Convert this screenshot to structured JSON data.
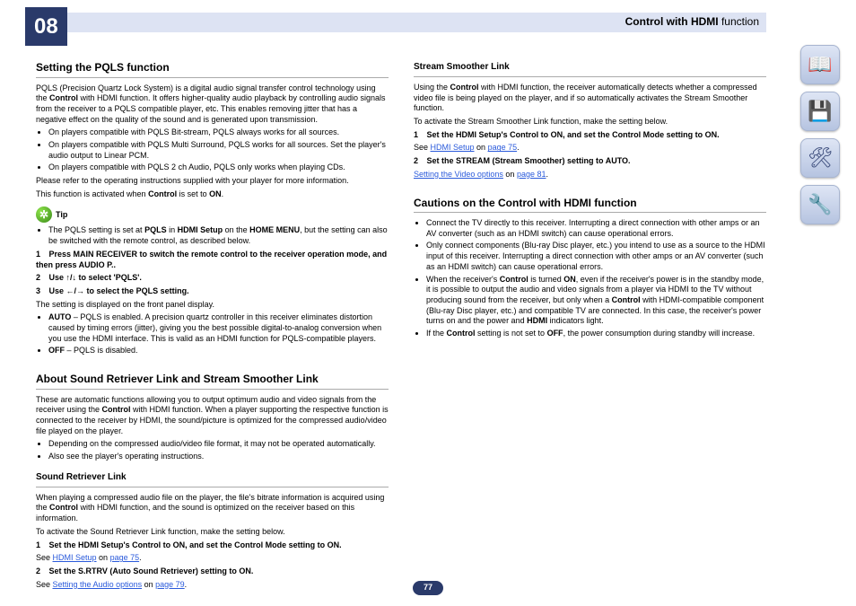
{
  "chapter": "08",
  "headerTitlePrefix": "Control with HDMI ",
  "headerTitleSuffix": "function",
  "pageNumber": "77",
  "left": {
    "s1": {
      "title": "Setting the PQLS function",
      "p1a": "PQLS (Precision Quartz Lock System) is a digital audio signal transfer control technology using the ",
      "p1b": "Control",
      "p1c": " with HDMI function. It offers higher-quality audio playback by controlling audio signals from the receiver to a PQLS compatible player, etc. This enables removing jitter that has a negative effect on the quality of the sound and is generated upon transmission.",
      "b1": "On players compatible with PQLS Bit-stream, PQLS always works for all sources.",
      "b2": "On players compatible with PQLS Multi Surround, PQLS works for all sources. Set the player's audio output to Linear PCM.",
      "b3": "On players compatible with PQLS 2 ch Audio, PQLS only works when playing CDs.",
      "p2": "Please refer to the operating instructions supplied with your player for more information.",
      "p3a": "This function is activated when ",
      "p3b": "Control",
      "p3c": " is set to ",
      "p3d": "ON",
      "p3e": ".",
      "tip": "Tip",
      "tipb1a": "The PQLS setting is set at ",
      "tipb1b": "PQLS",
      "tipb1c": " in ",
      "tipb1d": "HDMI Setup",
      "tipb1e": " on the ",
      "tipb1f": "HOME MENU",
      "tipb1g": ", but the setting can also be switched with the remote control, as described below.",
      "st1a": "Press MAIN RECEIVER to switch the remote control to the receiver operation mode, and then press AUDIO P..",
      "st2a": "Use ",
      "st2b": "↑/↓",
      "st2c": " to select 'PQLS'.",
      "st3a": "Use ",
      "st3b": "←/→",
      "st3c": " to select the PQLS setting.",
      "p4": "The setting is displayed on the front panel display.",
      "sb1a": "AUTO",
      "sb1b": " – PQLS is enabled. A precision quartz controller in this receiver eliminates distortion caused by timing errors (jitter), giving you the best possible digital-to-analog conversion when you use the HDMI interface. This is valid as an HDMI function for PQLS-compatible players.",
      "sb2a": "OFF",
      "sb2b": " – PQLS is disabled."
    },
    "s2": {
      "title": "About Sound Retriever Link and Stream Smoother Link",
      "p1a": "These are automatic functions allowing you to output optimum audio and video signals from the receiver using the ",
      "p1b": "Control",
      "p1c": " with HDMI function. When a player supporting the respective function is connected to the receiver by HDMI, the sound/picture is optimized for the compressed audio/video file played on the player.",
      "b1": "Depending on the compressed audio/video file format, it may not be operated automatically.",
      "b2": "Also see the player's operating instructions.",
      "sub": "Sound Retriever Link",
      "p2a": "When playing a compressed audio file on the player, the file's bitrate information is acquired using the ",
      "p2b": "Control",
      "p2c": " with HDMI function, and the sound is optimized on the receiver based on this information.",
      "p3": "To activate the Sound Retriever Link function, make the setting below.",
      "st1": "Set the HDMI Setup's Control to ON, and set the Control Mode setting to ON.",
      "see1a": "See ",
      "see1L": "HDMI Setup",
      "see1b": " on ",
      "see1P": "page 75",
      "see1c": ".",
      "st2": "Set the S.RTRV (Auto Sound Retriever) setting to ON.",
      "see2a": "See ",
      "see2L": "Setting the Audio options",
      "see2b": " on ",
      "see2P": "page 79",
      "see2c": "."
    }
  },
  "right": {
    "s1": {
      "sub": "Stream Smoother Link",
      "p1a": "Using the ",
      "p1b": "Control",
      "p1c": " with HDMI function, the receiver automatically detects whether a compressed video file is being played on the player, and if so automatically activates the Stream Smoother function.",
      "p2": "To activate the Stream Smoother Link function, make the setting below.",
      "st1": "Set the HDMI Setup's Control to ON, and set the Control Mode setting to ON.",
      "see1a": "See ",
      "see1L": "HDMI Setup",
      "see1b": " on ",
      "see1P": "page 75",
      "see1c": ".",
      "st2": "Set the STREAM (Stream Smoother) setting to AUTO.",
      "see2a": "See ",
      "see2L": "Setting the Video options",
      "see2b": " on ",
      "see2P": "page 81",
      "see2c": "."
    },
    "s2": {
      "title": "Cautions on the Control with HDMI function",
      "b1": "Connect the TV directly to this receiver. Interrupting a direct connection with other amps or an AV converter (such as an HDMI switch) can cause operational errors.",
      "b2": "Only connect components (Blu-ray Disc player, etc.) you intend to use as a source to the HDMI input of this receiver. Interrupting a direct connection with other amps or an AV converter (such as an HDMI switch) can cause operational errors.",
      "b3a": "When the receiver's ",
      "b3b": "Control",
      "b3c": " is turned ",
      "b3d": "ON",
      "b3e": ", even if the receiver's power is in the standby mode, it is possible to output the audio and video signals from a player via HDMI to the TV without producing sound from the receiver, but only when a ",
      "b3f": "Control",
      "b3g": " with HDMI-compatible component (Blu-ray Disc player, etc.) and compatible TV are connected. In this case, the receiver's power turns on and the power and ",
      "b3h": "HDMI",
      "b3i": " indicators light.",
      "b4a": "If the ",
      "b4b": "Control",
      "b4c": " setting is not set to ",
      "b4d": "OFF",
      "b4e": ", the power consumption during standby will increase."
    }
  },
  "side": {
    "a": "📖",
    "b": "💾",
    "c": "🛠",
    "d": "🔧"
  }
}
